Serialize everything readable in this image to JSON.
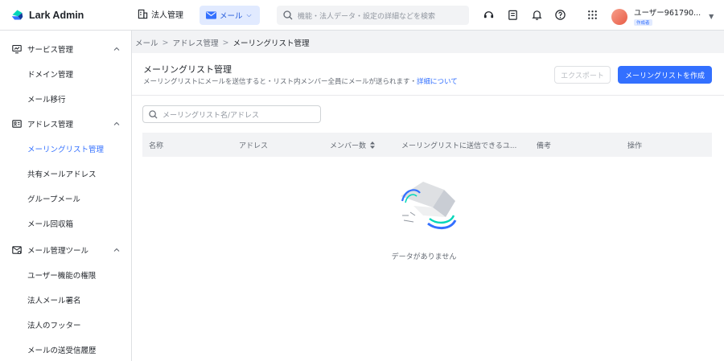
{
  "app": {
    "title": "Lark Admin"
  },
  "topbar": {
    "corp_label": "法人管理",
    "mail_tab_label": "メール",
    "search_placeholder": "機能・法人データ・設定の詳細などを検索",
    "user_name": "ユーザー961790...",
    "user_tag": "作成者"
  },
  "sidebar": {
    "groups": [
      {
        "label": "サービス管理",
        "items": [
          "ドメイン管理",
          "メール移行"
        ]
      },
      {
        "label": "アドレス管理",
        "items": [
          "メーリングリスト管理",
          "共有メールアドレス",
          "グループメール",
          "メール回収箱"
        ]
      },
      {
        "label": "メール管理ツール",
        "items": [
          "ユーザー機能の権限",
          "法人メール署名",
          "法人のフッター",
          "メールの送受信履歴"
        ]
      }
    ],
    "active_item": "メーリングリスト管理"
  },
  "breadcrumb": [
    "メール",
    "アドレス管理",
    "メーリングリスト管理"
  ],
  "page": {
    "title": "メーリングリスト管理",
    "description": "メーリングリストにメールを送信すると・リスト内メンバー全員にメールが送られます・",
    "description_link": "詳細について",
    "export_button": "エクスポート",
    "create_button": "メーリングリストを作成",
    "list_search_placeholder": "メーリングリスト名/アドレス"
  },
  "table": {
    "columns": [
      "名称",
      "アドレス",
      "メンバー数",
      "メーリングリストに送信できるユ...",
      "備考",
      "操作"
    ],
    "rows": [],
    "empty_text": "データがありません"
  },
  "colors": {
    "accent": "#3370ff",
    "text": "#1f2329",
    "muted": "#646a73"
  }
}
